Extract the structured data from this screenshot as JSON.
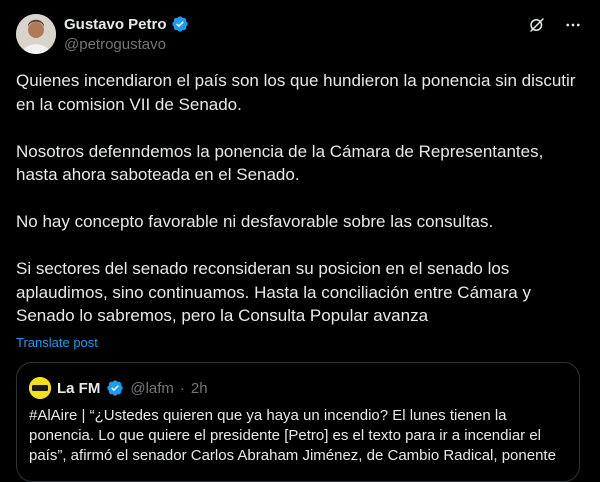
{
  "author": {
    "name": "Gustavo Petro",
    "handle": "@petrogustavo"
  },
  "tweet": {
    "text": "Quienes incendiaron el país son los que hundieron la ponencia sin discutir en la comision VII de Senado.\n\nNosotros defenndemos la ponencia de la Cámara de Representantes, hasta ahora saboteada en el Senado.\n\nNo hay concepto favorable ni desfavorable sobre las consultas.\n\nSi sectores del senado reconsideran su posicion en el senado los aplaudimos, sino continuamos. Hasta la conciliación entre Cámara y Senado lo sabremos, pero la Consulta Popular avanza",
    "translate_label": "Translate post"
  },
  "quoted": {
    "name": "La FM",
    "handle": "@lafm",
    "separator": "·",
    "time": "2h",
    "text": "#AlAire | “¿Ustedes quieren que ya haya un incendio? El lunes tienen la ponencia. Lo que quiere el presidente [Petro] es el texto para ir a incendiar el país”, afirmó el senador Carlos Abraham Jiménez, de Cambio Radical, ponente"
  },
  "colors": {
    "background": "#000000",
    "text": "#e7e9ea",
    "secondary": "#71767b",
    "accent": "#1d9bf0",
    "verified_personal": "#1d9bf0",
    "verified_org": "#e8b829"
  },
  "icons": {
    "verified": "verified-badge-icon",
    "grok": "grok-icon",
    "more": "more-icon"
  }
}
